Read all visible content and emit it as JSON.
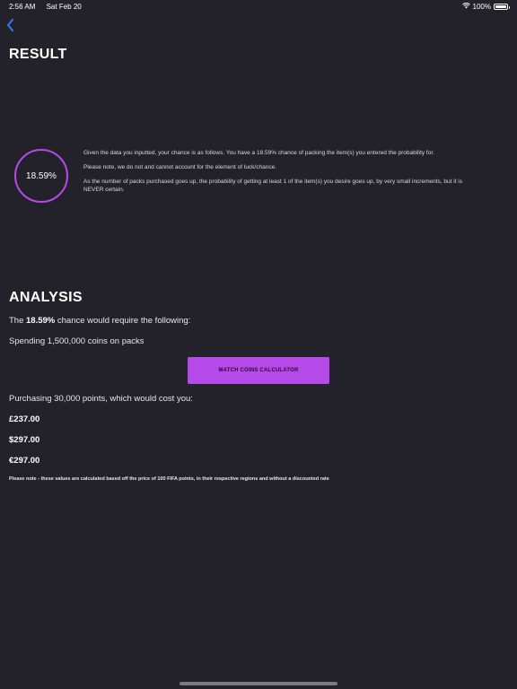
{
  "status_bar": {
    "time": "2:56 AM",
    "date": "Sat Feb 20",
    "battery": "100%",
    "battery_level": 1.0
  },
  "navigation": {
    "back_icon": "chevron-left-icon"
  },
  "result": {
    "title": "RESULT",
    "chance": "18.59%",
    "paragraphs": [
      "Given the data you inputted, your chance is as follows. You have a 18.59% chance of packing the item(s) you entered the probability for.",
      "Please note, we do not and cannot account for the element of luck/chance.",
      "As the number of packs purchased goes up, the probability of getting at least 1 of the item(s) you desire goes up, by very small increments, but it is NEVER certain."
    ]
  },
  "analysis": {
    "title": "ANALYSIS",
    "requires_prefix": "The ",
    "requires_chance": "18.59%",
    "requires_suffix": " chance would require the following:",
    "spending": "Spending 1,500,000 coins on packs",
    "calculator_button": "MATCH COINS CALCULATOR",
    "purchasing": "Purchasing 30,000 points, which would cost you:",
    "prices": {
      "gbp": "£237.00",
      "usd": "$297.00",
      "eur": "€297.00"
    },
    "disclaimer": "Please note - these values are calculated based off the price of 100 FIFA points, in their respective regions and without a discounted rate"
  },
  "colors": {
    "background": "#23222a",
    "accent": "#b64ae8",
    "text": "#ffffff",
    "back_icon": "#2f7cf6"
  }
}
